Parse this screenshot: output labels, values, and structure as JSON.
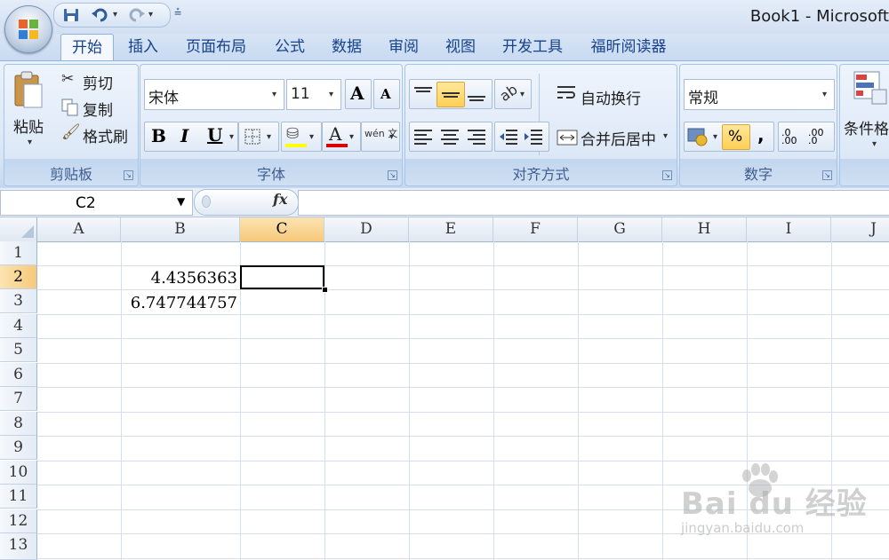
{
  "window": {
    "title": "Book1 - Microsoft"
  },
  "tabs": [
    "开始",
    "插入",
    "页面布局",
    "公式",
    "数据",
    "审阅",
    "视图",
    "开发工具",
    "福昕阅读器"
  ],
  "clipboard": {
    "paste": "粘贴",
    "cut": "剪切",
    "copy": "复制",
    "format_painter": "格式刷",
    "label": "剪贴板"
  },
  "font": {
    "name": "宋体",
    "size": "11",
    "bold": "B",
    "italic": "I",
    "underline": "U",
    "font_color_glyph": "A",
    "phonetic_glyph": "wén 文",
    "label": "字体"
  },
  "alignment": {
    "wrap_text": "自动换行",
    "merge_center": "合并后居中",
    "label": "对齐方式"
  },
  "number": {
    "format": "常规",
    "percent": "%",
    "comma": ",",
    "inc_decimal": ".0 .00",
    "dec_decimal": ".00 .0",
    "label": "数字"
  },
  "styles": {
    "conditional_format": "条件格"
  },
  "formula_bar": {
    "name_box": "C2",
    "fx": "fx",
    "content": ""
  },
  "columns": [
    "A",
    "B",
    "C",
    "D",
    "E",
    "F",
    "G",
    "H",
    "I",
    "J"
  ],
  "rows": [
    "1",
    "2",
    "3",
    "4",
    "5",
    "6",
    "7",
    "8",
    "9",
    "10",
    "11",
    "12",
    "13"
  ],
  "cells": {
    "B2": "4.4356363",
    "B3": "6.747744757"
  },
  "selection": {
    "cell": "C2"
  },
  "watermark": {
    "main": "Bai du 经验",
    "sub": "jingyan.baidu.com"
  },
  "colors": {
    "ribbon": "#dbe7f6",
    "tab_text": "#15428b",
    "selected_header": "#f7c97a",
    "gridline": "#d6e0ec"
  }
}
